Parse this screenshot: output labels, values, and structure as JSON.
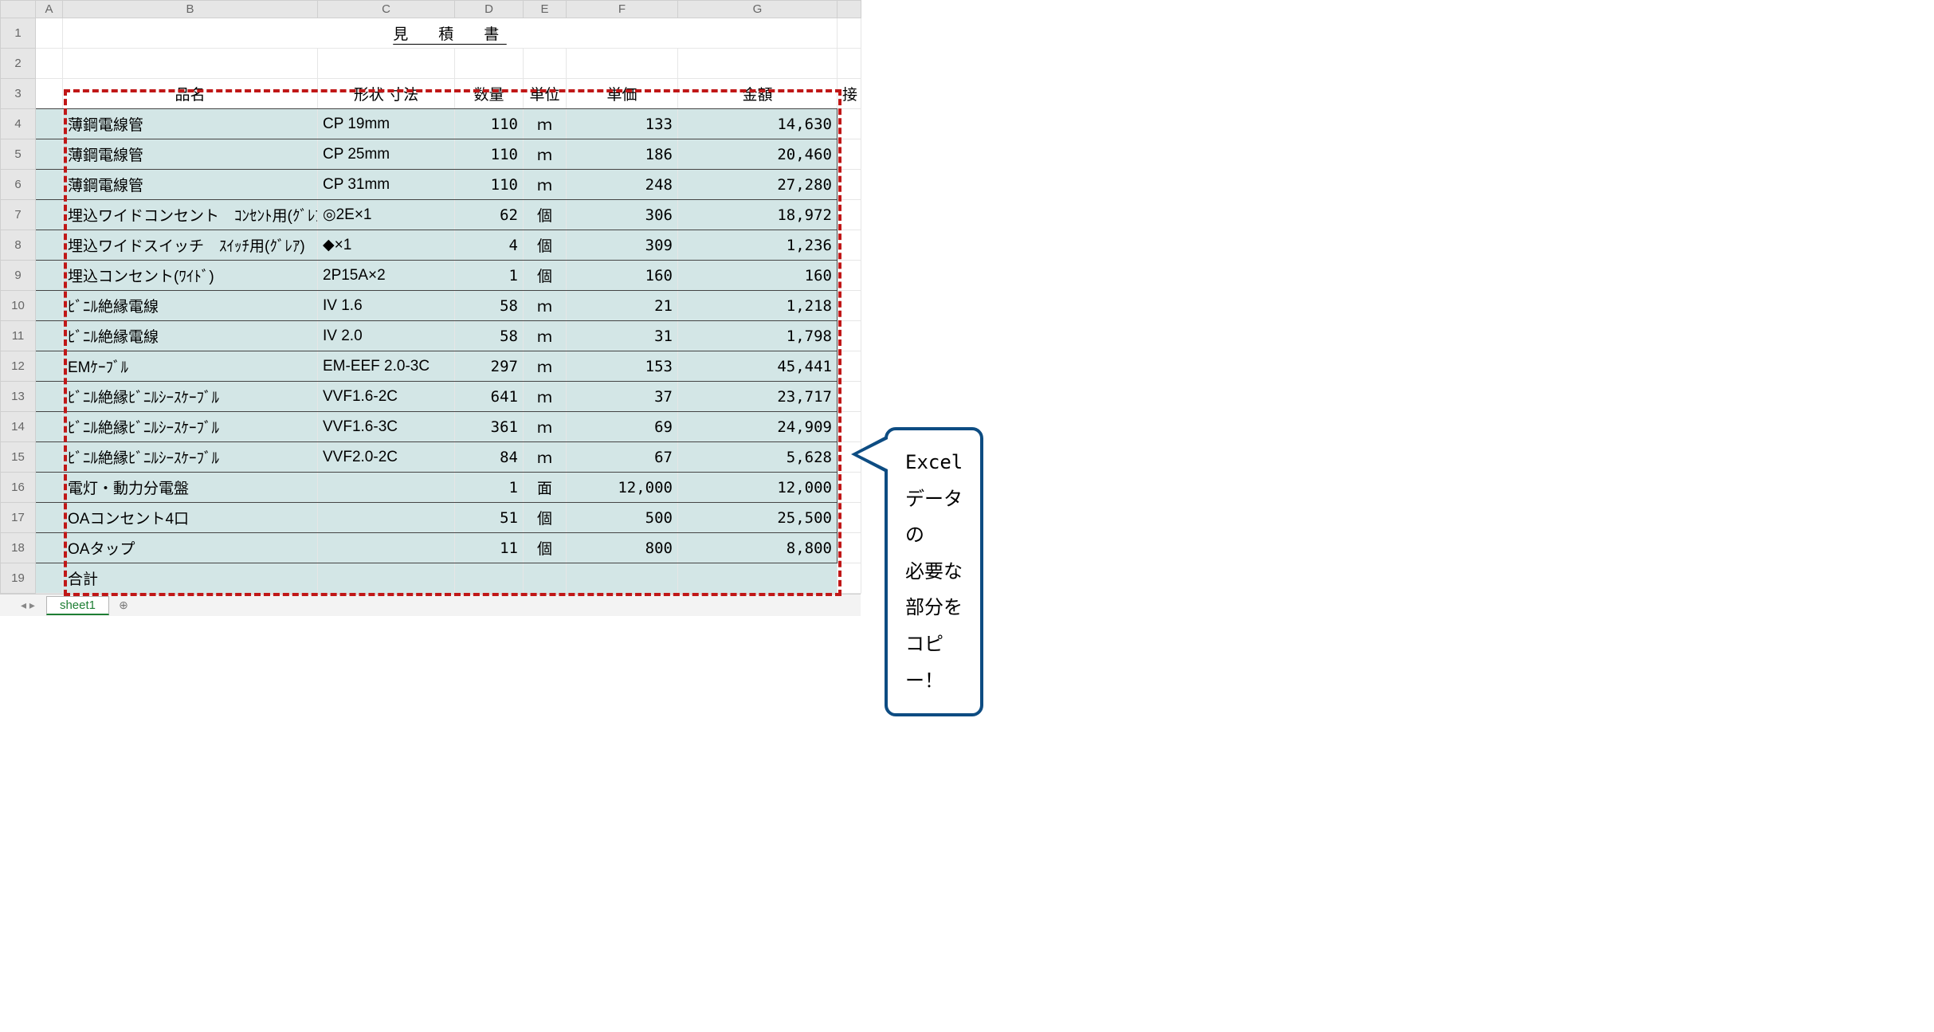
{
  "cols": [
    "A",
    "B",
    "C",
    "D",
    "E",
    "F",
    "G"
  ],
  "title": "見　積　書",
  "headers": {
    "name": "品名",
    "shape": "形状 寸法",
    "qty": "数量",
    "unit": "単位",
    "price": "単価",
    "amount": "金額",
    "overflow": "接"
  },
  "rows": [
    {
      "n": "4",
      "name": "薄鋼電線管",
      "shape": "CP 19mm",
      "qty": "110",
      "unit": "ｍ",
      "price": "133",
      "amount": "14,630"
    },
    {
      "n": "5",
      "name": "薄鋼電線管",
      "shape": "CP 25mm",
      "qty": "110",
      "unit": "ｍ",
      "price": "186",
      "amount": "20,460"
    },
    {
      "n": "6",
      "name": "薄鋼電線管",
      "shape": "CP 31mm",
      "qty": "110",
      "unit": "ｍ",
      "price": "248",
      "amount": "27,280"
    },
    {
      "n": "7",
      "name": "埋込ワイドコンセント　ｺﾝｾﾝﾄ用(ｸﾞﾚｱ",
      "shape": "◎2E×1",
      "qty": "62",
      "unit": "個",
      "price": "306",
      "amount": "18,972"
    },
    {
      "n": "8",
      "name": "埋込ワイドスイッチ　ｽｲｯﾁ用(ｸﾞﾚｱ)",
      "shape": "◆×1",
      "qty": "4",
      "unit": "個",
      "price": "309",
      "amount": "1,236"
    },
    {
      "n": "9",
      "name": "埋込コンセント(ﾜｲﾄﾞ)",
      "shape": "2P15A×2",
      "qty": "1",
      "unit": "個",
      "price": "160",
      "amount": "160"
    },
    {
      "n": "10",
      "name": "ﾋﾞﾆﾙ絶縁電線",
      "shape": "IV 1.6",
      "qty": "58",
      "unit": "ｍ",
      "price": "21",
      "amount": "1,218"
    },
    {
      "n": "11",
      "name": "ﾋﾞﾆﾙ絶縁電線",
      "shape": "IV 2.0",
      "qty": "58",
      "unit": "ｍ",
      "price": "31",
      "amount": "1,798"
    },
    {
      "n": "12",
      "name": "EMｹｰﾌﾞﾙ",
      "shape": "EM-EEF 2.0-3C",
      "qty": "297",
      "unit": "ｍ",
      "price": "153",
      "amount": "45,441"
    },
    {
      "n": "13",
      "name": "ﾋﾞﾆﾙ絶縁ﾋﾞﾆﾙｼｰｽｹｰﾌﾞﾙ",
      "shape": "VVF1.6-2C",
      "qty": "641",
      "unit": "ｍ",
      "price": "37",
      "amount": "23,717"
    },
    {
      "n": "14",
      "name": "ﾋﾞﾆﾙ絶縁ﾋﾞﾆﾙｼｰｽｹｰﾌﾞﾙ",
      "shape": "VVF1.6-3C",
      "qty": "361",
      "unit": "ｍ",
      "price": "69",
      "amount": "24,909"
    },
    {
      "n": "15",
      "name": "ﾋﾞﾆﾙ絶縁ﾋﾞﾆﾙｼｰｽｹｰﾌﾞﾙ",
      "shape": "VVF2.0-2C",
      "qty": "84",
      "unit": "ｍ",
      "price": "67",
      "amount": "5,628"
    },
    {
      "n": "16",
      "name": "電灯・動力分電盤",
      "shape": "",
      "qty": "1",
      "unit": "面",
      "price": "12,000",
      "amount": "12,000"
    },
    {
      "n": "17",
      "name": "OAコンセント4口",
      "shape": "",
      "qty": "51",
      "unit": "個",
      "price": "500",
      "amount": "25,500"
    },
    {
      "n": "18",
      "name": "OAタップ",
      "shape": "",
      "qty": "11",
      "unit": "個",
      "price": "800",
      "amount": "8,800"
    }
  ],
  "sumLabel": "合計",
  "sumRowNum": "19",
  "tab": "sheet1",
  "tabNav": "◂  ▸",
  "tabAdd": "⊕",
  "callout": {
    "line1": "Excelデータの",
    "line2": "必要な部分をコピー！"
  },
  "chart_data": {
    "type": "table",
    "title": "見積書",
    "columns": [
      "品名",
      "形状 寸法",
      "数量",
      "単位",
      "単価",
      "金額"
    ],
    "rows": [
      [
        "薄鋼電線管",
        "CP 19mm",
        110,
        "ｍ",
        133,
        14630
      ],
      [
        "薄鋼電線管",
        "CP 25mm",
        110,
        "ｍ",
        186,
        20460
      ],
      [
        "薄鋼電線管",
        "CP 31mm",
        110,
        "ｍ",
        248,
        27280
      ],
      [
        "埋込ワイドコンセント　ｺﾝｾﾝﾄ用(ｸﾞﾚｱ)",
        "◎2E×1",
        62,
        "個",
        306,
        18972
      ],
      [
        "埋込ワイドスイッチ　ｽｲｯﾁ用(ｸﾞﾚｱ)",
        "◆×1",
        4,
        "個",
        309,
        1236
      ],
      [
        "埋込コンセント(ﾜｲﾄﾞ)",
        "2P15A×2",
        1,
        "個",
        160,
        160
      ],
      [
        "ﾋﾞﾆﾙ絶縁電線",
        "IV 1.6",
        58,
        "ｍ",
        21,
        1218
      ],
      [
        "ﾋﾞﾆﾙ絶縁電線",
        "IV 2.0",
        58,
        "ｍ",
        31,
        1798
      ],
      [
        "EMｹｰﾌﾞﾙ",
        "EM-EEF 2.0-3C",
        297,
        "ｍ",
        153,
        45441
      ],
      [
        "ﾋﾞﾆﾙ絶縁ﾋﾞﾆﾙｼｰｽｹｰﾌﾞﾙ",
        "VVF1.6-2C",
        641,
        "ｍ",
        37,
        23717
      ],
      [
        "ﾋﾞﾆﾙ絶縁ﾋﾞﾆﾙｼｰｽｹｰﾌﾞﾙ",
        "VVF1.6-3C",
        361,
        "ｍ",
        69,
        24909
      ],
      [
        "ﾋﾞﾆﾙ絶縁ﾋﾞﾆﾙｼｰｽｹｰﾌﾞﾙ",
        "VVF2.0-2C",
        84,
        "ｍ",
        67,
        5628
      ],
      [
        "電灯・動力分電盤",
        "",
        1,
        "面",
        12000,
        12000
      ],
      [
        "OAコンセント4口",
        "",
        51,
        "個",
        500,
        25500
      ],
      [
        "OAタップ",
        "",
        11,
        "個",
        800,
        8800
      ]
    ]
  }
}
